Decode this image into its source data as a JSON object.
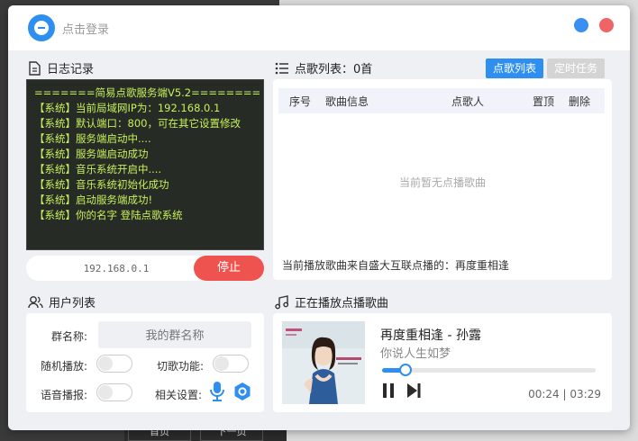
{
  "background": {
    "pager": [
      "首页",
      "下一页"
    ]
  },
  "titlebar": {
    "login_text": "点击登录"
  },
  "log": {
    "title": "日志记录",
    "lines": [
      "=======简易点歌服务端V5.2========",
      "【系统】当前局域网IP为：192.168.0.1",
      "【系统】默认端口：800，可在其它设置修改",
      "【系统】服务端启动中....",
      "【系统】服务端启动成功",
      "【系统】音乐系统开启中....",
      "【系统】音乐系统初始化成功",
      "【系统】启动服务端成功!",
      "【系统】你的名字 登陆点歌系统"
    ],
    "ip_value": "192.168.0.1",
    "stop_label": "停止"
  },
  "songlist": {
    "title": "点歌列表：0首",
    "tabs": [
      "点歌列表",
      "定时任务"
    ],
    "columns": [
      "序号",
      "歌曲信息",
      "点歌人",
      "置顶",
      "删除"
    ],
    "empty_text": "当前暂无点播歌曲",
    "source_text": "当前播放歌曲来自盛大互联点播的：再度重相逢"
  },
  "users": {
    "title": "用户列表",
    "group_label": "群名称:",
    "group_placeholder": "我的群名称",
    "random_label": "随机播放:",
    "cut_label": "切歌功能:",
    "voice_label": "语音播报:",
    "settings_label": "相关设置:"
  },
  "player": {
    "title": "正在播放点播歌曲",
    "track": "再度重相逢 - 孙露",
    "subtitle": "你说人生如梦",
    "elapsed": "00:24",
    "separator": "|",
    "total": "03:29",
    "progress": 0.11,
    "colors": {
      "accent": "#2f8ff0",
      "stop": "#ef5350"
    }
  }
}
